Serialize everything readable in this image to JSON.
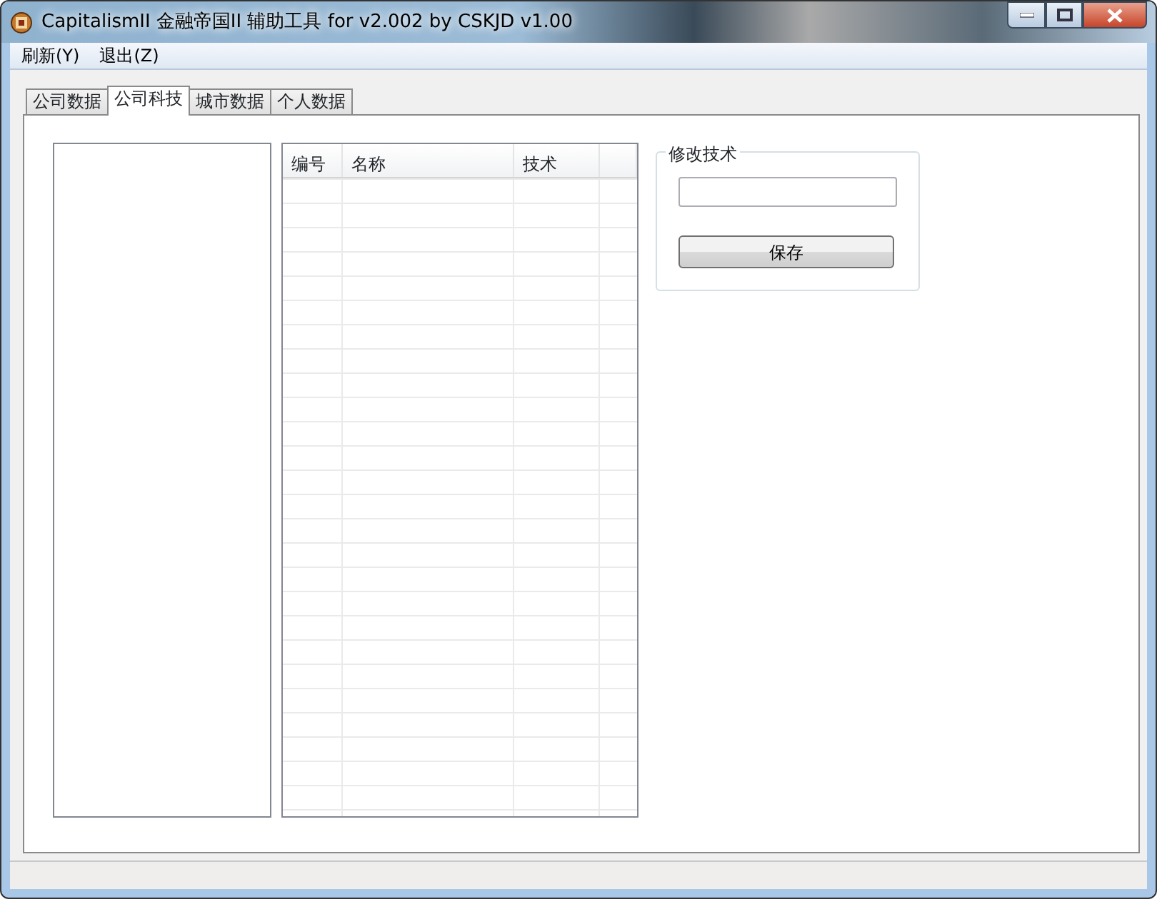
{
  "window": {
    "title": "CapitalismII 金融帝国II 辅助工具 for v2.002 by CSKJD v1.00"
  },
  "menu": [
    {
      "label": "刷新(Y)"
    },
    {
      "label": "退出(Z)"
    }
  ],
  "tabs": [
    {
      "label": "公司数据",
      "selected": false
    },
    {
      "label": "公司科技",
      "selected": true
    },
    {
      "label": "城市数据",
      "selected": false
    },
    {
      "label": "个人数据",
      "selected": false
    }
  ],
  "table": {
    "columns": [
      "编号",
      "名称",
      "技术"
    ]
  },
  "edit_group": {
    "legend": "修改技术",
    "button": "保存"
  }
}
